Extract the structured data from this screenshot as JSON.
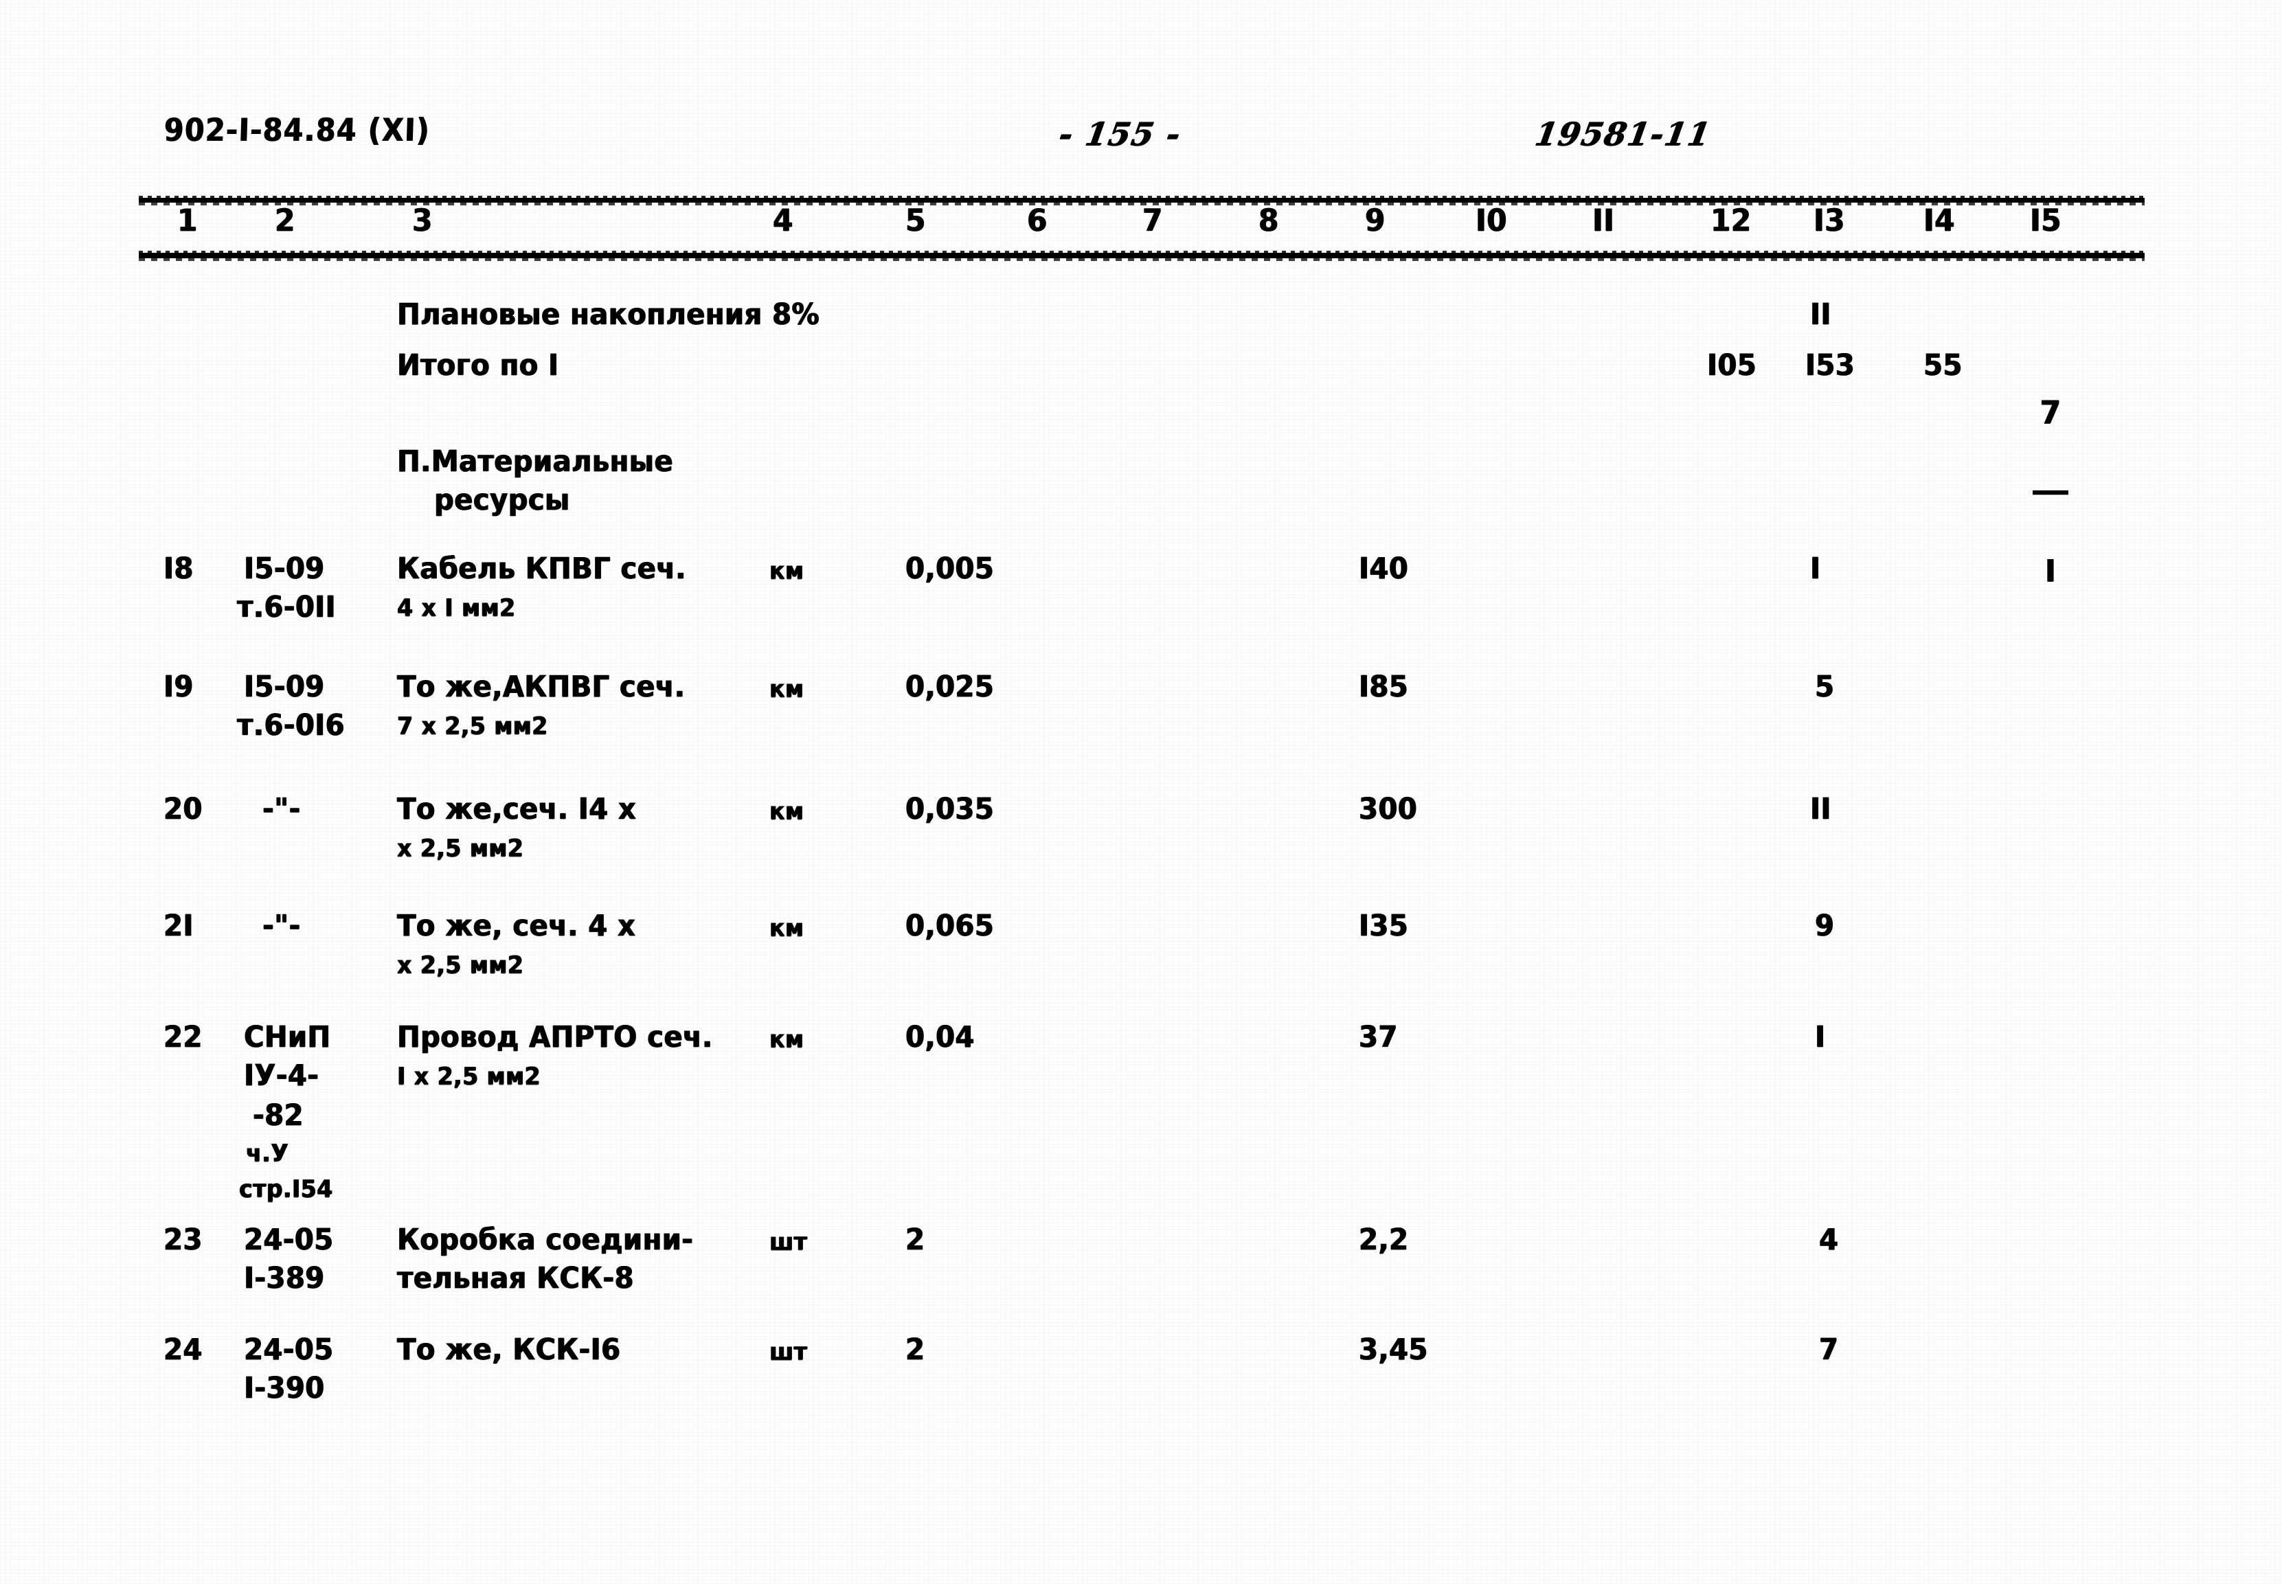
{
  "header": {
    "doc_code": "902-I-84.84  (XI)",
    "page_marker": "- 155 -",
    "archive_number": "19581-11"
  },
  "table": {
    "column_numbers": [
      "1",
      "2",
      "3",
      "4",
      "5",
      "6",
      "7",
      "8",
      "9",
      "I0",
      "II",
      "12",
      "I3",
      "I4",
      "I5"
    ],
    "summary_rows": [
      {
        "name": "Плановые накопления 8%",
        "col12": "",
        "col13": "II",
        "col14": "",
        "col15": ""
      },
      {
        "name": "Итого по I",
        "col12": "I05",
        "col13": "I53",
        "col14": "55",
        "col15_numerator": "7",
        "col15_denominator": "I"
      }
    ],
    "section_heading": {
      "line1": "П.Материальные",
      "line2": "ресурсы"
    },
    "rows": [
      {
        "num": "I8",
        "code_line1": "I5-09",
        "code_line2": "т.6-0II",
        "name_line1": "Кабель КПВГ сеч.",
        "name_line2": "4 х I мм2",
        "unit": "км",
        "qty": "0,005",
        "col9": "I40",
        "col13": "I"
      },
      {
        "num": "I9",
        "code_line1": "I5-09",
        "code_line2": "т.6-0I6",
        "name_line1": "То же,АКПВГ сеч.",
        "name_line2": "7 х 2,5 мм2",
        "unit": "км",
        "qty": "0,025",
        "col9": "I85",
        "col13": "5"
      },
      {
        "num": "20",
        "code_line1": "-\"-",
        "code_line2": "",
        "name_line1": "То же,сеч. I4 х",
        "name_line2": "х 2,5 мм2",
        "unit": "км",
        "qty": "0,035",
        "col9": "300",
        "col13": "II"
      },
      {
        "num": "2I",
        "code_line1": "-\"-",
        "code_line2": "",
        "name_line1": "То же, сеч. 4 х",
        "name_line2": "х 2,5 мм2",
        "unit": "км",
        "qty": "0,065",
        "col9": "I35",
        "col13": "9"
      },
      {
        "num": "22",
        "code_line1": "СНиП",
        "code_line2": "IУ-4-",
        "code_line3": "-82",
        "code_line4": "ч.У",
        "code_line5": "стр.I54",
        "name_line1": "Провод АПРТО сеч.",
        "name_line2": "I х 2,5 мм2",
        "unit": "км",
        "qty": "0,04",
        "col9": "37",
        "col13": "I"
      },
      {
        "num": "23",
        "code_line1": "24-05",
        "code_line2": "I-389",
        "name_line1": "Коробка соедини-",
        "name_line2": "тельная КСК-8",
        "unit": "шт",
        "qty": "2",
        "col9": "2,2",
        "col13": "4"
      },
      {
        "num": "24",
        "code_line1": "24-05",
        "code_line2": "I-390",
        "name_line1": "То же, КСК-I6",
        "name_line2": "",
        "unit": "шт",
        "qty": "2",
        "col9": "3,45",
        "col13": "7"
      }
    ]
  }
}
